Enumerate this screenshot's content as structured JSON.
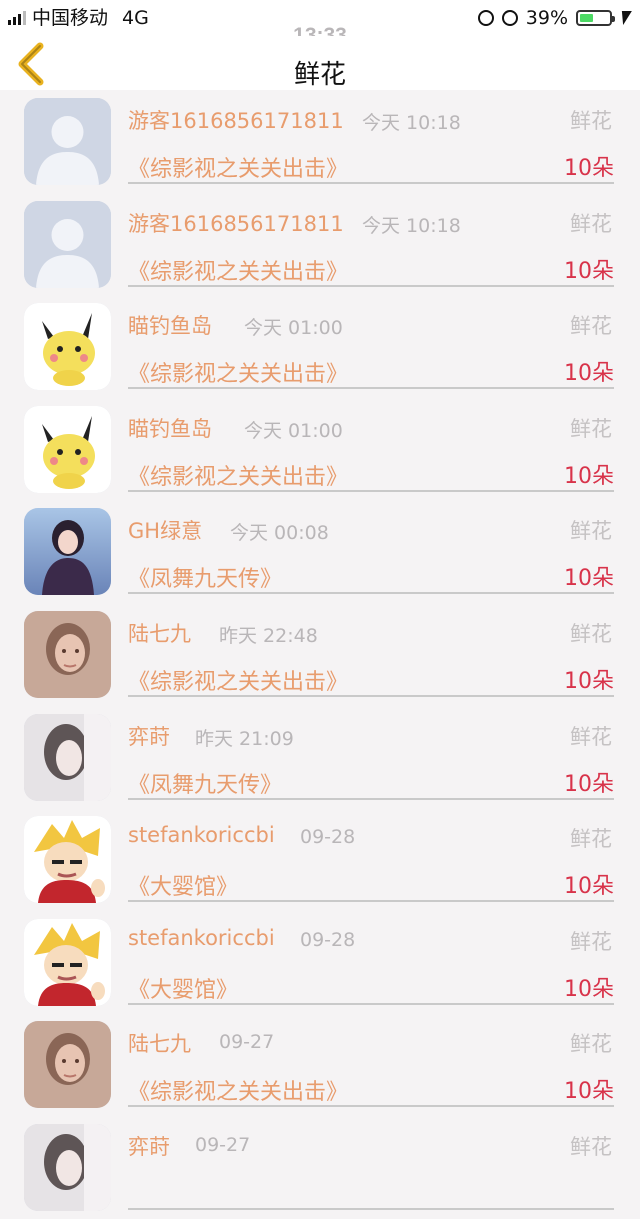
{
  "status_bar": {
    "carrier": "中国移动",
    "network": "4G",
    "time": "13:33",
    "battery": "39%"
  },
  "nav": {
    "title": "鲜花"
  },
  "colors": {
    "accent": "#e89c6d",
    "count": "#d8334a",
    "muted": "#b9b6b8"
  },
  "items": [
    {
      "name": "游客1616856171811",
      "time": "今天 10:18",
      "type": "鲜花",
      "book": "《综影视之关关出击》",
      "count": "10朵",
      "avatar": "default-avatar"
    },
    {
      "name": "游客1616856171811",
      "time": "今天 10:18",
      "type": "鲜花",
      "book": "《综影视之关关出击》",
      "count": "10朵",
      "avatar": "default-avatar"
    },
    {
      "name": "瞄钓鱼岛",
      "time": "今天 01:00",
      "type": "鲜花",
      "book": "《综影视之关关出击》",
      "count": "10朵",
      "avatar": "pikachu-avatar"
    },
    {
      "name": "瞄钓鱼岛",
      "time": "今天 01:00",
      "type": "鲜花",
      "book": "《综影视之关关出击》",
      "count": "10朵",
      "avatar": "pikachu-avatar"
    },
    {
      "name": "GH绿意",
      "time": "今天 00:08",
      "type": "鲜花",
      "book": "《凤舞九天传》",
      "count": "10朵",
      "avatar": "anime-girl-avatar"
    },
    {
      "name": "陆七九",
      "time": "昨天 22:48",
      "type": "鲜花",
      "book": "《综影视之关关出击》",
      "count": "10朵",
      "avatar": "girl-photo-avatar"
    },
    {
      "name": "弈莳",
      "time": "昨天 21:09",
      "type": "鲜花",
      "book": "《凤舞九天传》",
      "count": "10朵",
      "avatar": "grey-girl-avatar"
    },
    {
      "name": "stefankoriccbi",
      "time": "09-28",
      "type": "鲜花",
      "book": "《大婴馆》",
      "count": "10朵",
      "avatar": "cartoon-boy-avatar"
    },
    {
      "name": "stefankoriccbi",
      "time": "09-28",
      "type": "鲜花",
      "book": "《大婴馆》",
      "count": "10朵",
      "avatar": "cartoon-boy-avatar"
    },
    {
      "name": "陆七九",
      "time": "09-27",
      "type": "鲜花",
      "book": "《综影视之关关出击》",
      "count": "10朵",
      "avatar": "girl-photo-avatar"
    },
    {
      "name": "弈莳",
      "time": "09-27",
      "type": "鲜花",
      "book": "",
      "count": "",
      "avatar": "grey-girl-avatar"
    }
  ]
}
